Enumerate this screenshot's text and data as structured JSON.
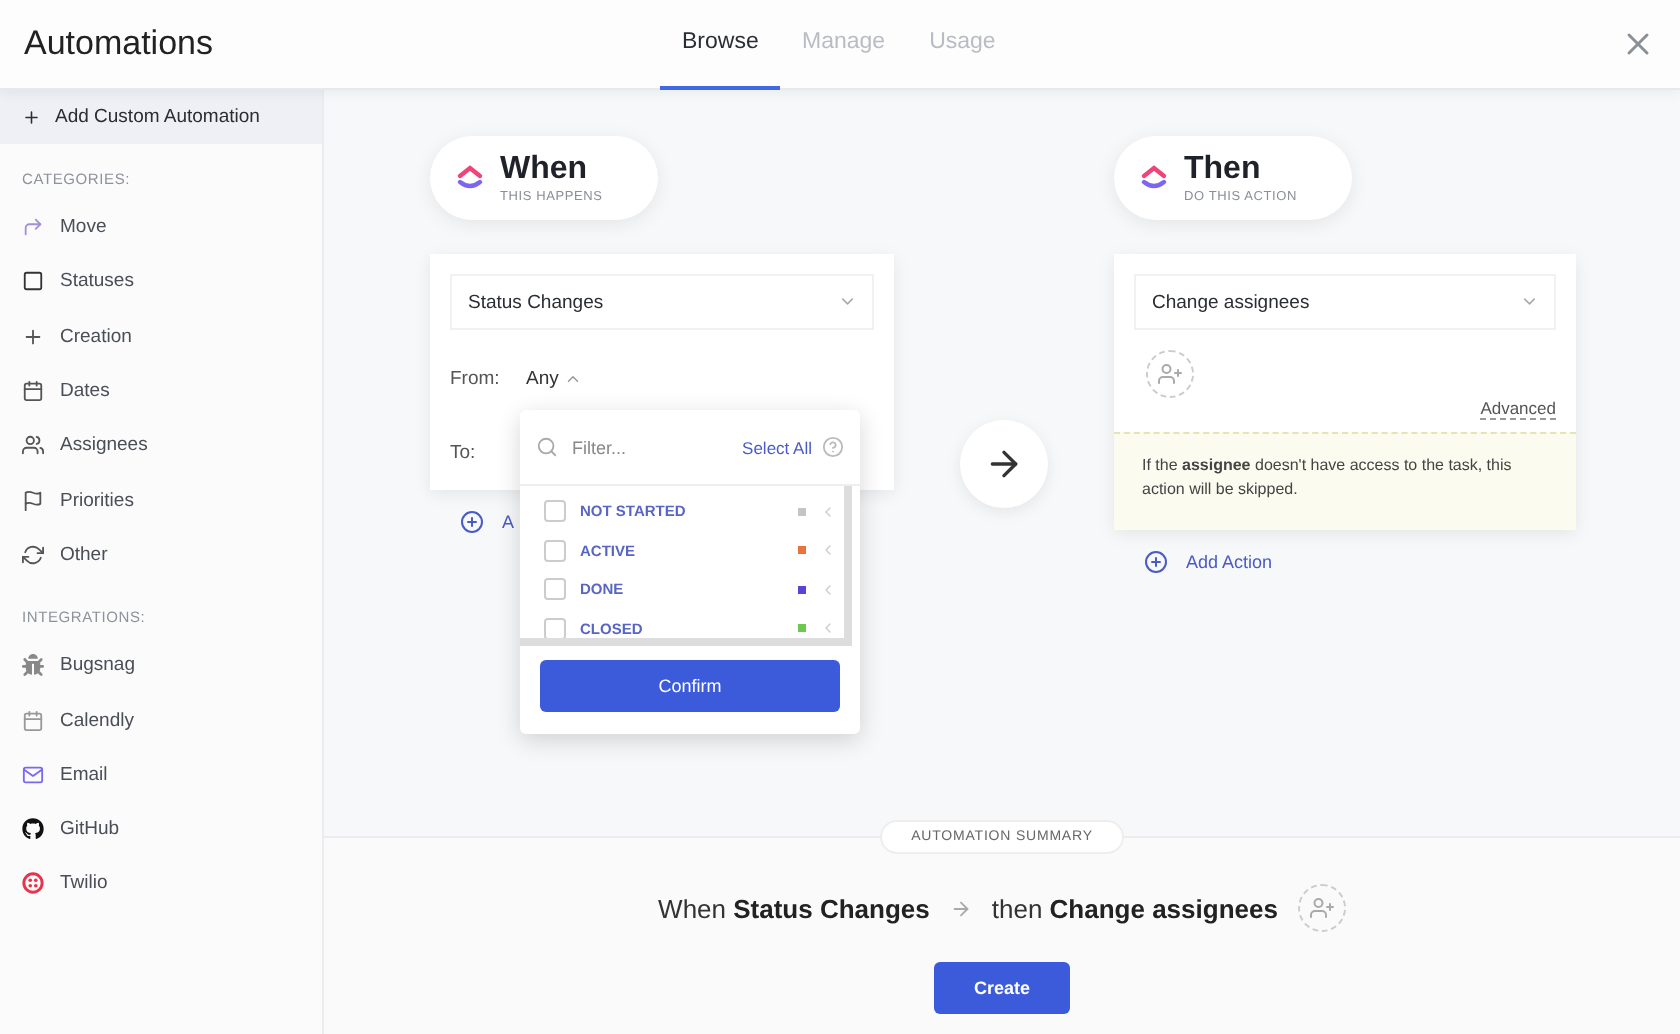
{
  "window": {
    "title": "Automations"
  },
  "tabs": [
    {
      "label": "Browse",
      "selected": true
    },
    {
      "label": "Manage",
      "selected": false
    },
    {
      "label": "Usage",
      "selected": false
    }
  ],
  "sidebar": {
    "add_button": "Add Custom Automation",
    "sections": [
      {
        "heading": "CATEGORIES:",
        "items": [
          "Move",
          "Statuses",
          "Creation",
          "Dates",
          "Assignees",
          "Priorities",
          "Other"
        ]
      },
      {
        "heading": "INTEGRATIONS:",
        "items": [
          "Bugsnag",
          "Calendly",
          "Email",
          "GitHub",
          "Twilio"
        ]
      }
    ]
  },
  "trigger": {
    "title": "When",
    "subtitle": "THIS HAPPENS",
    "select": "Status Changes",
    "from_label": "From:",
    "from_value": "Any",
    "to_label": "To:",
    "add_link": "A"
  },
  "status_picker": {
    "placeholder": "Filter...",
    "select_all": "Select All",
    "confirm": "Confirm",
    "options": [
      {
        "label": "NOT STARTED",
        "checked": false,
        "color": "#c4c4c4"
      },
      {
        "label": "ACTIVE",
        "checked": false,
        "color": "#e8743b"
      },
      {
        "label": "DONE",
        "checked": false,
        "color": "#5b43d6"
      },
      {
        "label": "CLOSED",
        "checked": false,
        "color": "#6bc950"
      }
    ]
  },
  "action": {
    "title": "Then",
    "subtitle": "DO THIS ACTION",
    "select": "Change assignees",
    "advanced": "Advanced",
    "notice": "If the **assignee** doesn't have access to the task, this action will be skipped.",
    "add_link": "Add Action"
  },
  "summary": {
    "heading": "AUTOMATION SUMMARY",
    "when": "When **Status Changes**",
    "then": "then **Change assignees**"
  },
  "create_button": "Create"
}
